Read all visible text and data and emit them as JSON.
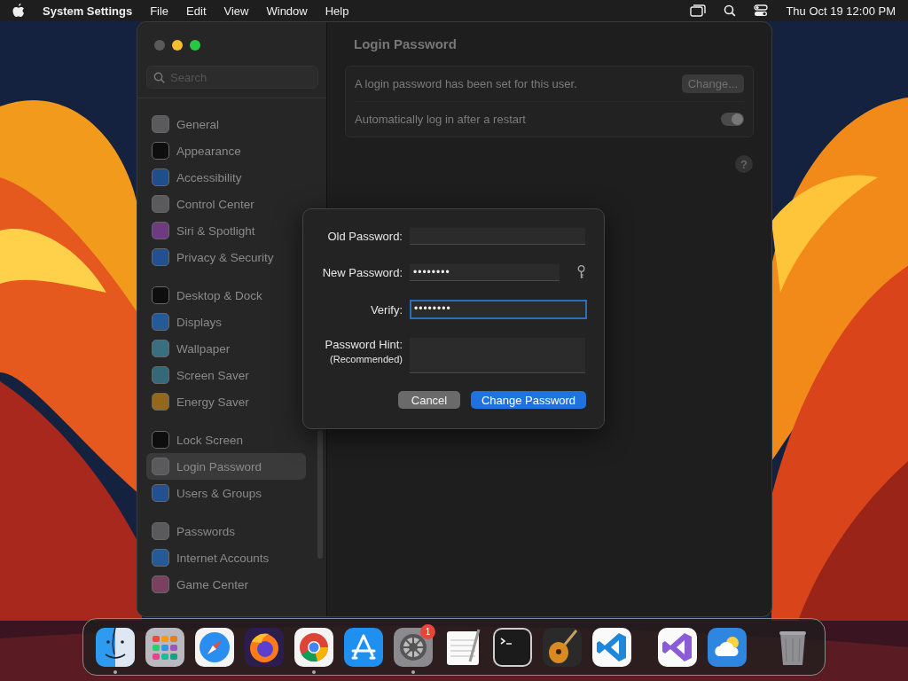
{
  "menu_bar": {
    "app_name": "System Settings",
    "menus": [
      "File",
      "Edit",
      "View",
      "Window",
      "Help"
    ],
    "clock": "Thu Oct 19  12:00 PM"
  },
  "window": {
    "search": {
      "placeholder": "Search"
    },
    "sidebar": {
      "groups": [
        {
          "items": [
            {
              "label": "General",
              "color": "#5a5a5c",
              "selected": false
            },
            {
              "label": "Appearance",
              "color": "#0e0e0e",
              "selected": false
            },
            {
              "label": "Accessibility",
              "color": "#1f4f8a",
              "selected": false
            },
            {
              "label": "Control Center",
              "color": "#5a5a5c",
              "selected": false
            },
            {
              "label": "Siri & Spotlight",
              "color": "#6e3a80",
              "selected": false
            },
            {
              "label": "Privacy & Security",
              "color": "#24508f",
              "selected": false
            }
          ]
        },
        {
          "items": [
            {
              "label": "Desktop & Dock",
              "color": "#0e0e0e",
              "selected": false
            },
            {
              "label": "Displays",
              "color": "#255a98",
              "selected": false
            },
            {
              "label": "Wallpaper",
              "color": "#3a6f80",
              "selected": false
            },
            {
              "label": "Screen Saver",
              "color": "#346a78",
              "selected": false
            },
            {
              "label": "Energy Saver",
              "color": "#92691a",
              "selected": false
            }
          ]
        },
        {
          "items": [
            {
              "label": "Lock Screen",
              "color": "#0e0e0e",
              "selected": false
            },
            {
              "label": "Login Password",
              "color": "#5a5a5c",
              "selected": true
            },
            {
              "label": "Users & Groups",
              "color": "#24508f",
              "selected": false
            }
          ]
        },
        {
          "items": [
            {
              "label": "Passwords",
              "color": "#5a5a5c",
              "selected": false
            },
            {
              "label": "Internet Accounts",
              "color": "#255a98",
              "selected": false
            },
            {
              "label": "Game Center",
              "color": "#7a4060",
              "selected": false
            }
          ]
        }
      ]
    },
    "content": {
      "title": "Login Password",
      "rows": [
        {
          "kind": "button",
          "label": "A login password has been set for this user.",
          "button": "Change..."
        },
        {
          "kind": "toggle",
          "label": "Automatically log in after a restart",
          "on": true
        }
      ],
      "help": "?"
    }
  },
  "dialog": {
    "fields": [
      {
        "label": "Old Password:",
        "focused": false,
        "key_button": false
      },
      {
        "label": "New Password:",
        "value": "••••••••",
        "focused": false,
        "key_button": true
      },
      {
        "label": "Verify:",
        "value": "••••••••",
        "focused": true,
        "key_button": false
      }
    ],
    "hint": {
      "label": "Password Hint:",
      "sublabel": "(Recommended)"
    },
    "cancel": "Cancel",
    "confirm": "Change Password"
  },
  "dock": {
    "groups": [
      {
        "items": [
          {
            "running": true
          },
          {
            "running": false
          },
          {
            "running": false
          },
          {
            "running": false
          },
          {
            "running": true
          },
          {
            "running": false
          },
          {
            "running": true,
            "badge": "1"
          },
          {
            "running": false
          },
          {
            "running": false
          },
          {
            "running": false
          },
          {
            "running": false
          }
        ]
      },
      {
        "items": [
          {
            "running": false
          },
          {
            "running": false
          }
        ]
      },
      {
        "items": [
          {
            "running": false
          }
        ]
      }
    ]
  }
}
